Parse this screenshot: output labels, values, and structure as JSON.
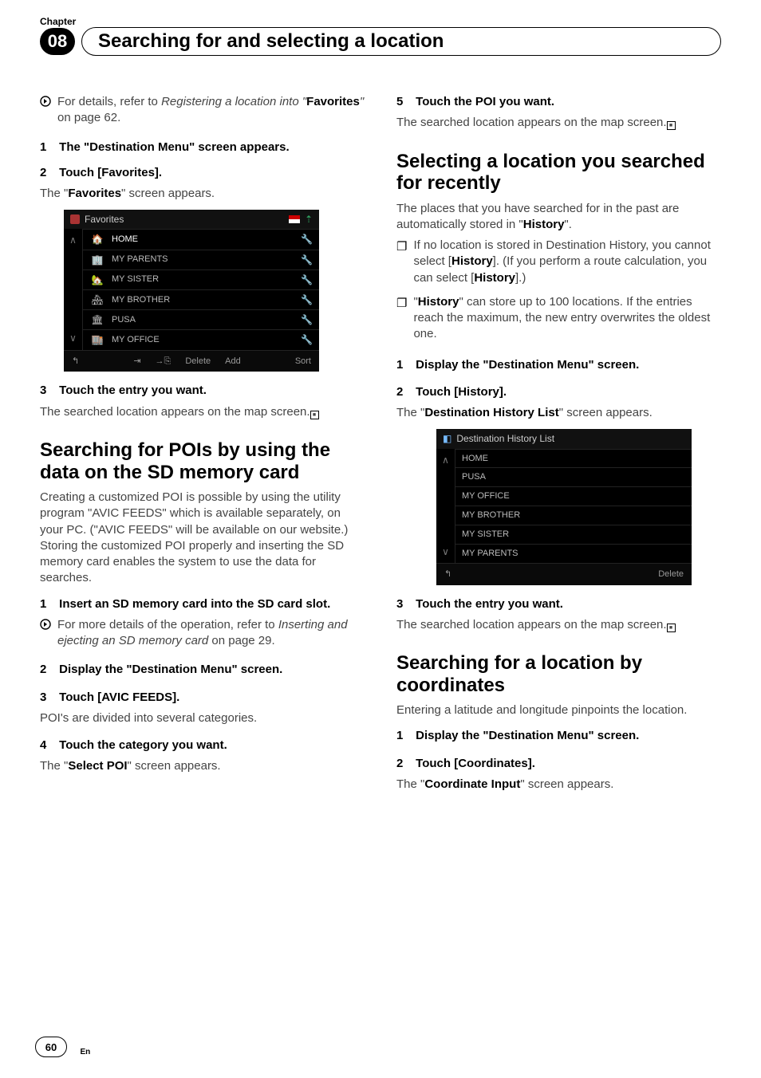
{
  "chapter": {
    "label": "Chapter",
    "number": "08",
    "title": "Searching for and selecting a location"
  },
  "left": {
    "ref1_prefix": "For details, refer to ",
    "ref1_italic1": "Registering a location into \"",
    "ref1_bold": "Favorites",
    "ref1_italic2": "\"",
    "ref1_after": " on page 62.",
    "step1": {
      "num": "1",
      "title": "The \"Destination Menu\" screen appears."
    },
    "step2": {
      "num": "2",
      "title": "Touch [Favorites]."
    },
    "step2_body_pre": "The \"",
    "step2_body_bold": "Favorites",
    "step2_body_post": "\" screen appears.",
    "favshot": {
      "title": "Favorites",
      "arrow_up": "∧",
      "arrow_down": "∨",
      "items": [
        {
          "label": "HOME"
        },
        {
          "label": "MY PARENTS"
        },
        {
          "label": "MY SISTER"
        },
        {
          "label": "MY BROTHER"
        },
        {
          "label": "PUSA"
        },
        {
          "label": "MY OFFICE"
        }
      ],
      "back": "↰",
      "btn_export": "⇥",
      "btn_import": "→⎘",
      "btn_delete": "Delete",
      "btn_add": "Add",
      "btn_sort": "Sort"
    },
    "step3": {
      "num": "3",
      "title": "Touch the entry you want."
    },
    "step3_body": "The searched location appears on the map screen.",
    "sectionPOI_title": "Searching for POIs by using the data on the SD memory card",
    "poi_intro": "Creating a customized POI is possible by using the utility program \"AVIC FEEDS\" which is available separately, on your PC. (\"AVIC FEEDS\" will be available on our website.) Storing the customized POI properly and inserting the SD memory card enables the system to use the data for searches.",
    "poi_step1": {
      "num": "1",
      "title": "Insert an SD memory card into the SD card slot."
    },
    "poi_ref_prefix": "For more details of the operation, refer to ",
    "poi_ref_italic": "Inserting and ejecting an SD memory card",
    "poi_ref_after": " on page 29.",
    "poi_step2": {
      "num": "2",
      "title": "Display the \"Destination Menu\" screen."
    },
    "poi_step3": {
      "num": "3",
      "title": "Touch [AVIC FEEDS]."
    },
    "poi_step3_body": "POI's are divided into several categories.",
    "poi_step4": {
      "num": "4",
      "title": "Touch the category you want."
    },
    "poi_step4_body_pre": "The \"",
    "poi_step4_body_bold": "Select POI",
    "poi_step4_body_post": "\" screen appears."
  },
  "right": {
    "poi_step5": {
      "num": "5",
      "title": "Touch the POI you want."
    },
    "poi_step5_body": "The searched location appears on the map screen.",
    "sectionRecent_title": "Selecting a location you searched for recently",
    "recent_intro_pre": "The places that you have searched for in the past are automatically stored in \"",
    "recent_intro_bold": "History",
    "recent_intro_post": "\".",
    "note1_pre": "If no location is stored in Destination History, you cannot select [",
    "note1_bold": "History",
    "note1_mid": "]. (If you perform a route calculation, you can select [",
    "note1_bold2": "History",
    "note1_post": "].)",
    "note2_pre": "\"",
    "note2_bold": "History",
    "note2_post": "\" can store up to 100 locations. If the entries reach the maximum, the new entry overwrites the oldest one.",
    "recent_step1": {
      "num": "1",
      "title": "Display the \"Destination Menu\" screen."
    },
    "recent_step2": {
      "num": "2",
      "title": "Touch [History]."
    },
    "recent_step2_body_pre": "The \"",
    "recent_step2_body_bold": "Destination History List",
    "recent_step2_body_post": "\" screen appears.",
    "histshot": {
      "title": "Destination History List",
      "arrow_up": "∧",
      "arrow_down": "∨",
      "items": [
        {
          "label": "HOME"
        },
        {
          "label": "PUSA"
        },
        {
          "label": "MY OFFICE"
        },
        {
          "label": "MY BROTHER"
        },
        {
          "label": "MY SISTER"
        },
        {
          "label": "MY PARENTS"
        }
      ],
      "back": "↰",
      "btn_delete": "Delete"
    },
    "recent_step3": {
      "num": "3",
      "title": "Touch the entry you want."
    },
    "recent_step3_body": "The searched location appears on the map screen.",
    "sectionCoord_title": "Searching for a location by coordinates",
    "coord_intro": "Entering a latitude and longitude pinpoints the location.",
    "coord_step1": {
      "num": "1",
      "title": "Display the \"Destination Menu\" screen."
    },
    "coord_step2": {
      "num": "2",
      "title": "Touch [Coordinates]."
    },
    "coord_step2_body_pre": "The \"",
    "coord_step2_body_bold": "Coordinate Input",
    "coord_step2_body_post": "\" screen appears."
  },
  "footer": {
    "page": "60",
    "lang": "En"
  },
  "icons": {
    "end_marker": "■",
    "note_marker": "❐",
    "wrench": "🔧"
  }
}
